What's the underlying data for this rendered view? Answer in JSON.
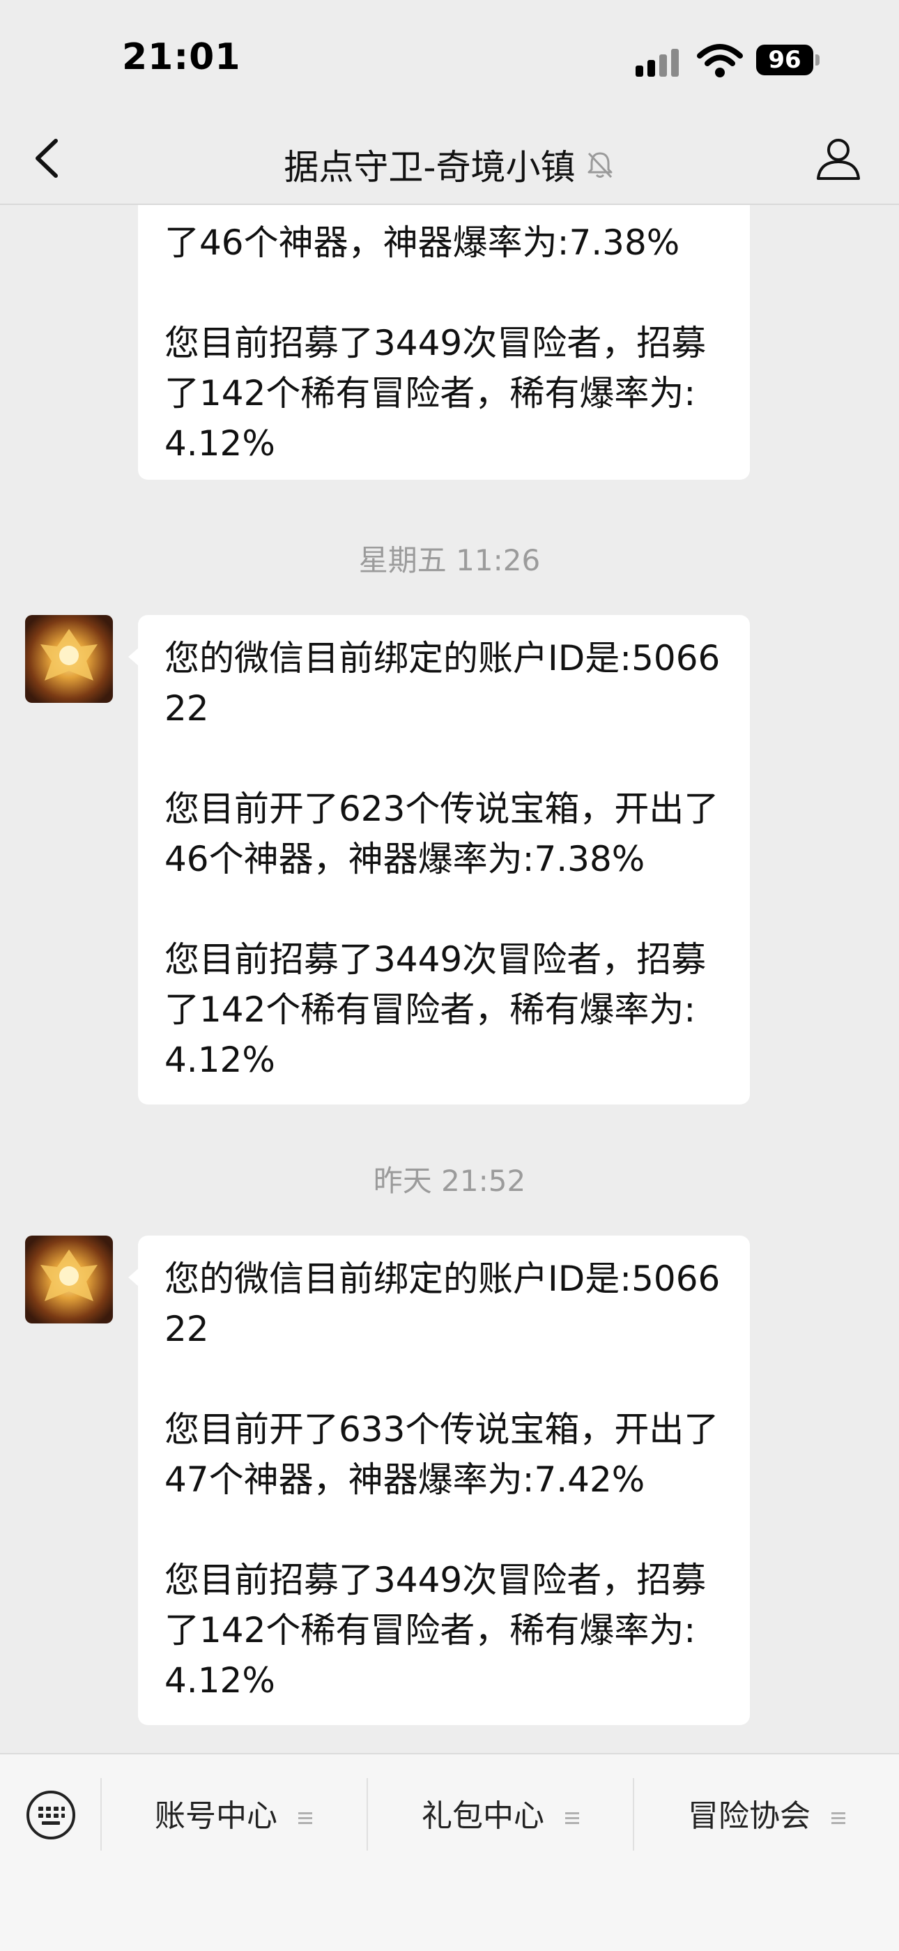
{
  "status_bar": {
    "time": "21:01",
    "battery": "96"
  },
  "nav": {
    "title": "据点守卫-奇境小镇"
  },
  "messages": [
    {
      "timestamp": "",
      "paragraphs": [
        "了46个神器，神器爆率为:7.38%",
        "您目前招募了3449次冒险者，招募了142个稀有冒险者，稀有爆率为:4.12%"
      ]
    },
    {
      "timestamp": "星期五 11:26",
      "paragraphs": [
        "您的微信目前绑定的账户ID是:506622",
        "您目前开了623个传说宝箱，开出了46个神器，神器爆率为:7.38%",
        "您目前招募了3449次冒险者，招募了142个稀有冒险者，稀有爆率为:4.12%"
      ]
    },
    {
      "timestamp": "昨天 21:52",
      "paragraphs": [
        "您的微信目前绑定的账户ID是:506622",
        "您目前开了633个传说宝箱，开出了47个神器，神器爆率为:7.42%",
        "您目前招募了3449次冒险者，招募了142个稀有冒险者，稀有爆率为:4.12%"
      ]
    }
  ],
  "menu": {
    "items": [
      "账号中心",
      "礼包中心",
      "冒险协会"
    ]
  },
  "icons": {
    "back": "chevron-left-icon",
    "mute": "bell-slash-icon",
    "profile": "person-icon",
    "keyboard": "keyboard-icon",
    "avatar": "golden-emblem-avatar"
  },
  "colors": {
    "background": "#ededed",
    "bubble": "#ffffff",
    "timestamp": "#9b9b9b"
  }
}
